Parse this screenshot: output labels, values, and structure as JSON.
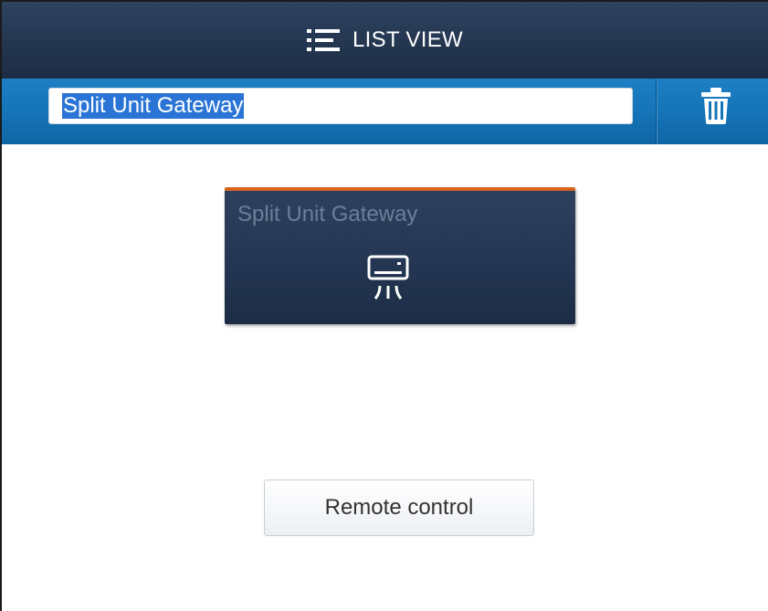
{
  "header": {
    "title": "LIST VIEW",
    "icon": "list-icon"
  },
  "name_bar": {
    "input_value": "Split Unit Gateway",
    "delete_icon": "trash-icon"
  },
  "tile": {
    "title": "Split Unit Gateway",
    "icon": "air-conditioner-icon",
    "accent_color": "#d8641e"
  },
  "actions": {
    "remote_control_label": "Remote control"
  },
  "colors": {
    "header_bg": "#243650",
    "name_bar_bg": "#1674b8",
    "selection": "#2a74d6",
    "tile_bg": "#233551"
  }
}
